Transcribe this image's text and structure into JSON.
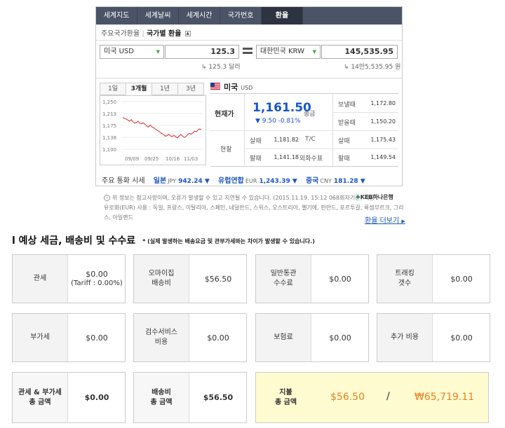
{
  "widget": {
    "tabs": [
      "세계지도",
      "세계날씨",
      "세계시간",
      "국가번호",
      "환율"
    ],
    "active_tab": 4,
    "breadcrumb_parent": "주요국가환율",
    "breadcrumb_current": "국가별 환율",
    "from_currency": "미국 USD",
    "from_amount": "125.3",
    "from_hint": "125.3 달러",
    "to_currency": "대한민국 KRW",
    "to_amount": "145,535.95",
    "to_hint": "14만5,535.95 원",
    "period_tabs": [
      "1일",
      "3개월",
      "1년",
      "3년"
    ],
    "active_period": 1,
    "country_name": "미국",
    "country_code": "USD",
    "current_label": "현재가",
    "current_rate": "1,161.50",
    "change": "▼ 9.50 -0.81%",
    "cash_label": "현찰",
    "buy_label": "살때",
    "sell_label": "팔때",
    "cash_buy": "1,181.82",
    "cash_sell": "1,141.18",
    "remit_label": "송금",
    "send_label": "보낼때",
    "receive_label": "받을때",
    "send_value": "1,172.80",
    "receive_value": "1,150.20",
    "tc_label": "T/C",
    "tc_buy": "1,175.43",
    "foreign_check_label": "외화수표",
    "foreign_check_sell": "1,149.54",
    "major_label": "주요 통화 시세",
    "major": [
      {
        "name": "일본",
        "code": "JPY",
        "value": "942.24 ▼"
      },
      {
        "name": "유럽연합",
        "code": "EUR",
        "value": "1,243.39 ▼"
      },
      {
        "name": "중국",
        "code": "CNY",
        "value": "181.28 ▼"
      }
    ],
    "note_icon": "i",
    "note_line1": "위 정보는 참고사항이며, 오류가 발생할 수 있고 지연될 수 있습니다. (2015.11.19. 15:12 068회차기준)   제공 :",
    "note_line2": "유로화(EUR) 사용 : 독일, 프랑스, 이탈리아, 스페인, 네덜란드, 스위스, 오스트리아, 벨기에, 핀란드, 포르투갈, 룩셈부르크, 그리스, 아일랜드",
    "provider": "KEB하나은행",
    "more_link": "환율 더보기"
  },
  "chart_data": {
    "type": "line",
    "x_ticks": [
      "09/09",
      "09/25",
      "10/16",
      "11/03"
    ],
    "y_ticks": [
      "1,250",
      "1,213",
      "1,175",
      "1,138",
      "1,100"
    ],
    "ylim": [
      1100,
      1250
    ],
    "values": [
      1200,
      1197,
      1195,
      1192,
      1188,
      1193,
      1186,
      1182,
      1184,
      1188,
      1182,
      1180,
      1183,
      1179,
      1174,
      1170,
      1176,
      1171,
      1168,
      1164,
      1160,
      1157,
      1153,
      1149,
      1146,
      1141,
      1143,
      1147,
      1142,
      1140,
      1144,
      1139,
      1136,
      1141,
      1146,
      1142,
      1137,
      1140,
      1146,
      1150,
      1147,
      1151,
      1157,
      1155,
      1160,
      1164,
      1161
    ],
    "color": "#d6282e"
  },
  "fees": {
    "title": "l 예상 세금, 배송비 및 수수료",
    "subtitle": "* (실제 발생하는 배송요금 및 관부가세와는 차이가 발생할 수 있습니다.)",
    "cards": [
      {
        "label": "관세",
        "value": "$0.00",
        "value2": "(Tariff : 0.00%)"
      },
      {
        "label": "오마이집\n배송비",
        "value": "$56.50",
        "value2": ""
      },
      {
        "label": "일반통관\n수수료",
        "value": "$0.00",
        "value2": ""
      },
      {
        "label": "트래킹\n갯수",
        "value": "$0.00",
        "value2": ""
      },
      {
        "label": "부가세",
        "value": "$0.00",
        "value2": ""
      },
      {
        "label": "검수서비스\n비용",
        "value": "$0.00",
        "value2": ""
      },
      {
        "label": "보험료",
        "value": "$0.00",
        "value2": ""
      },
      {
        "label": "추가 비용",
        "value": "$0.00",
        "value2": ""
      }
    ],
    "total_tax_label": "관세 & 부가세\n총 금액",
    "total_tax_value": "$0.00",
    "total_ship_label": "배송비\n총 금액",
    "total_ship_value": "$56.50",
    "pay_label": "지불\n총 금액",
    "pay_usd": "$56.50",
    "pay_sep": "/",
    "pay_krw": "₩65,719.11",
    "accent_color": "#e8801e",
    "pay_bg": "#fffbd1"
  }
}
